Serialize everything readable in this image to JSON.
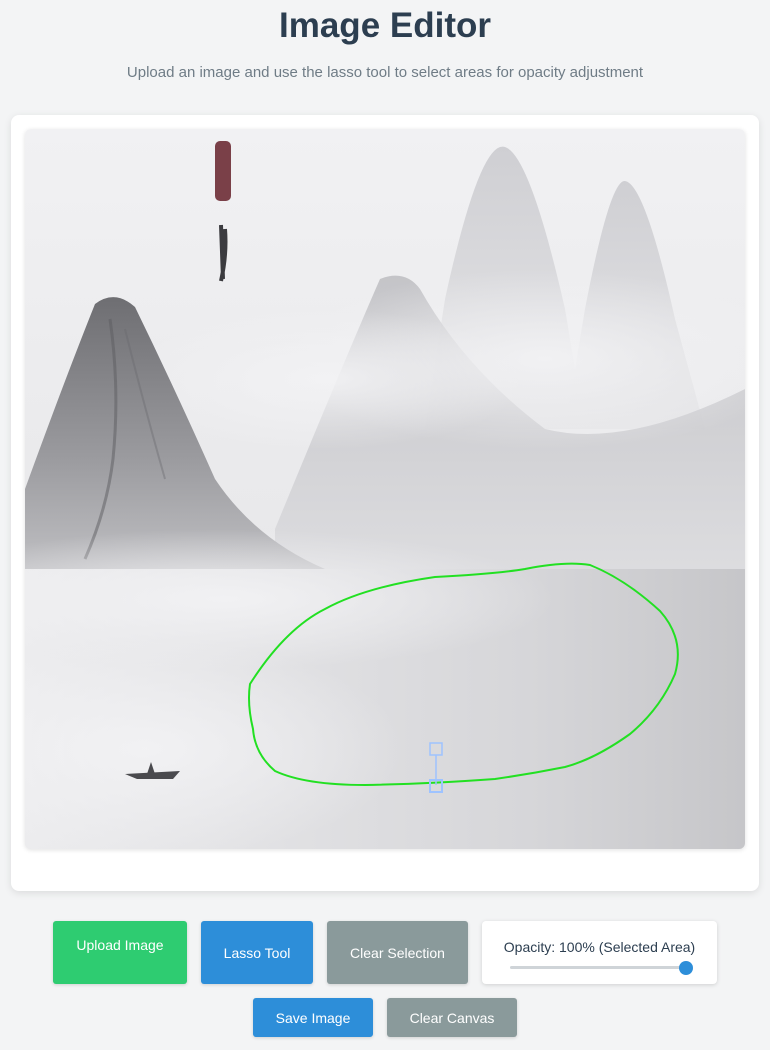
{
  "header": {
    "title": "Image Editor",
    "subtitle": "Upload an image and use the lasso tool to select areas for opacity adjustment"
  },
  "toolbar": {
    "upload_label": "Upload Image",
    "lasso_label": "Lasso Tool",
    "clear_selection_label": "Clear Selection",
    "save_label": "Save Image",
    "clear_canvas_label": "Clear Canvas"
  },
  "opacity": {
    "label": "Opacity: 100% (Selected Area)",
    "value": 100,
    "min": 0,
    "max": 100
  },
  "colors": {
    "title": "#2c3e50",
    "upload_button": "#2ecc71",
    "primary_button": "#2d8ed9",
    "secondary_button": "#8a9a9b",
    "lasso_selection": "#22e022",
    "handle": "#9ec3ff"
  },
  "canvas": {
    "content": "ink-wash mountain landscape",
    "has_selection": true
  }
}
